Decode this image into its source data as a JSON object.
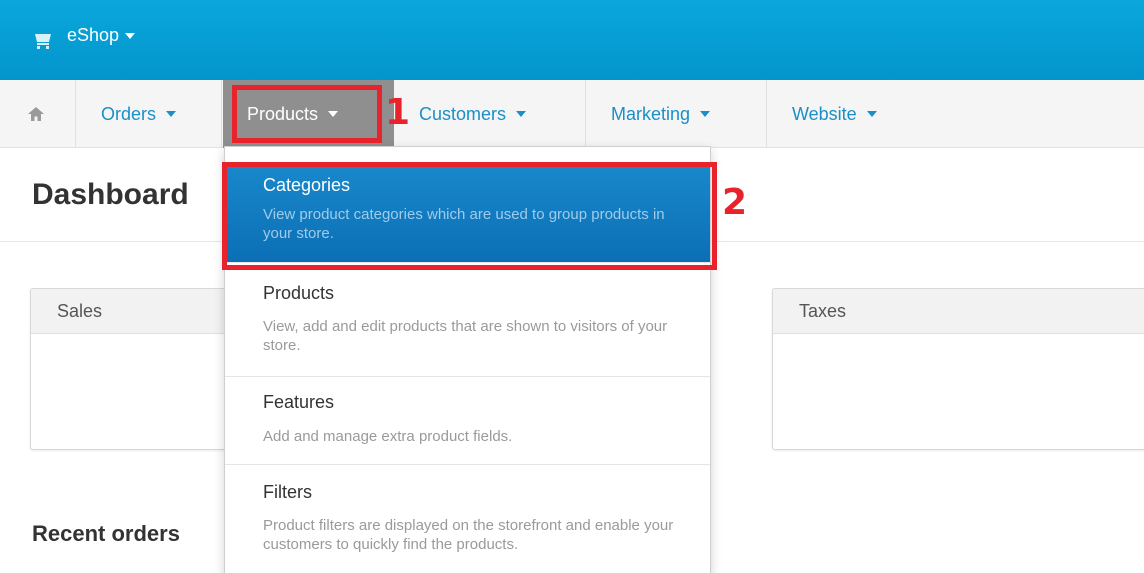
{
  "topbar": {
    "brand": "eShop"
  },
  "nav": {
    "items": [
      {
        "label": "Orders"
      },
      {
        "label": "Products"
      },
      {
        "label": "Customers"
      },
      {
        "label": "Marketing"
      },
      {
        "label": "Website"
      }
    ]
  },
  "annotations": {
    "marker1": "1",
    "marker2": "2"
  },
  "page": {
    "title": "Dashboard",
    "recent_orders": "Recent orders",
    "panels": {
      "sales": {
        "title": "Sales"
      },
      "taxes": {
        "title": "Taxes",
        "big_value": "$",
        "small_value": "$"
      }
    }
  },
  "dropdown": {
    "items": [
      {
        "title": "Categories",
        "desc": "View product categories which are used to group products in your store."
      },
      {
        "title": "Products",
        "desc": "View, add and edit products that are shown to visitors of your store."
      },
      {
        "title": "Features",
        "desc": "Add and manage extra product fields."
      },
      {
        "title": "Filters",
        "desc": "Product filters are displayed on the storefront and enable your customers to quickly find the products."
      }
    ]
  },
  "colors": {
    "topbar": "#0aa7dc",
    "link": "#1a8fc8",
    "highlight": "#e8232b",
    "menu_active": "#0b6fb5"
  },
  "icons": {
    "topbar": "cart-icon",
    "home": "home-icon"
  }
}
